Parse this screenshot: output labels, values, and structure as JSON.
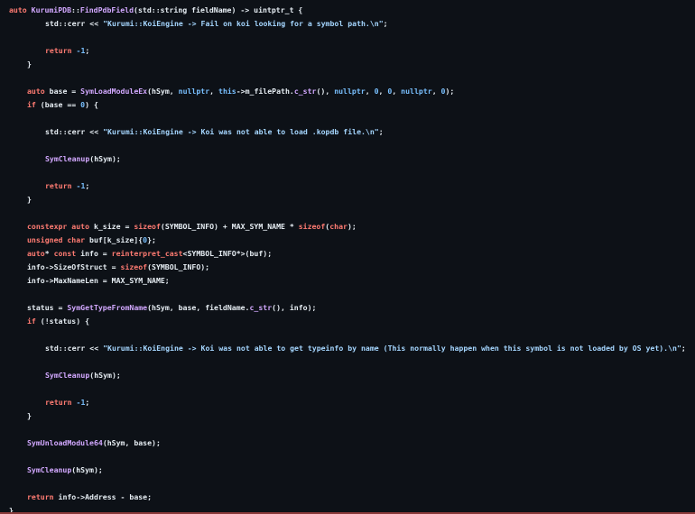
{
  "theme": {
    "background": "#0d1117",
    "text": "#e6edf3",
    "keyword": "#ff7b72",
    "function": "#d2a8ff",
    "type": "#79c0ff",
    "string": "#a5d6ff",
    "number": "#79c0ff"
  },
  "code": {
    "lines": [
      {
        "indent": 0,
        "tokens": [
          {
            "t": "auto ",
            "c": "keyword"
          },
          {
            "t": "KurumiPDB",
            "c": "function"
          },
          {
            "t": "::",
            "c": "plain"
          },
          {
            "t": "FindPdbField",
            "c": "function"
          },
          {
            "t": "(std::string fieldName) -> uintptr_t {",
            "c": "plain"
          }
        ]
      },
      {
        "indent": 2,
        "tokens": [
          {
            "t": "std::cerr << ",
            "c": "plain"
          },
          {
            "t": "\"Kurumi::KoiEngine -> Fail on koi looking for a symbol path.\\n\"",
            "c": "string"
          },
          {
            "t": ";",
            "c": "plain"
          }
        ]
      },
      {
        "indent": 2,
        "tokens": [
          {
            "t": "return ",
            "c": "keyword"
          },
          {
            "t": "-1",
            "c": "number"
          },
          {
            "t": ";",
            "c": "plain"
          }
        ]
      },
      {
        "indent": 1,
        "tokens": [
          {
            "t": "}",
            "c": "plain"
          }
        ]
      },
      {
        "indent": 1,
        "tokens": [
          {
            "t": "auto ",
            "c": "keyword"
          },
          {
            "t": "base = ",
            "c": "plain"
          },
          {
            "t": "SymLoadModuleEx",
            "c": "function"
          },
          {
            "t": "(hSym, ",
            "c": "plain"
          },
          {
            "t": "nullptr",
            "c": "type"
          },
          {
            "t": ", ",
            "c": "plain"
          },
          {
            "t": "this",
            "c": "type"
          },
          {
            "t": "->m_filePath.",
            "c": "plain"
          },
          {
            "t": "c_str",
            "c": "function"
          },
          {
            "t": "(), ",
            "c": "plain"
          },
          {
            "t": "nullptr",
            "c": "type"
          },
          {
            "t": ", ",
            "c": "plain"
          },
          {
            "t": "0",
            "c": "number"
          },
          {
            "t": ", ",
            "c": "plain"
          },
          {
            "t": "0",
            "c": "number"
          },
          {
            "t": ", ",
            "c": "plain"
          },
          {
            "t": "nullptr",
            "c": "type"
          },
          {
            "t": ", ",
            "c": "plain"
          },
          {
            "t": "0",
            "c": "number"
          },
          {
            "t": ");",
            "c": "plain"
          }
        ]
      },
      {
        "indent": 1,
        "tokens": [
          {
            "t": "if ",
            "c": "keyword"
          },
          {
            "t": "(base == ",
            "c": "plain"
          },
          {
            "t": "0",
            "c": "number"
          },
          {
            "t": ") {",
            "c": "plain"
          }
        ]
      },
      {
        "indent": 2,
        "tokens": [
          {
            "t": "std::cerr << ",
            "c": "plain"
          },
          {
            "t": "\"Kurumi::KoiEngine -> Koi was not able to load .kopdb file.\\n\"",
            "c": "string"
          },
          {
            "t": ";",
            "c": "plain"
          }
        ]
      },
      {
        "indent": 2,
        "tokens": [
          {
            "t": "SymCleanup",
            "c": "function"
          },
          {
            "t": "(hSym);",
            "c": "plain"
          }
        ]
      },
      {
        "indent": 2,
        "tokens": [
          {
            "t": "return ",
            "c": "keyword"
          },
          {
            "t": "-1",
            "c": "number"
          },
          {
            "t": ";",
            "c": "plain"
          }
        ]
      },
      {
        "indent": 1,
        "tokens": [
          {
            "t": "}",
            "c": "plain"
          }
        ]
      },
      {
        "indent": 1,
        "tokens": [
          {
            "t": "constexpr auto ",
            "c": "keyword"
          },
          {
            "t": "k_size = ",
            "c": "plain"
          },
          {
            "t": "sizeof",
            "c": "keyword"
          },
          {
            "t": "(SYMBOL_INFO) + MAX_SYM_NAME * ",
            "c": "plain"
          },
          {
            "t": "sizeof",
            "c": "keyword"
          },
          {
            "t": "(",
            "c": "plain"
          },
          {
            "t": "char",
            "c": "keyword"
          },
          {
            "t": ");",
            "c": "plain"
          }
        ]
      },
      {
        "indent": 1,
        "tokens": [
          {
            "t": "unsigned char ",
            "c": "keyword"
          },
          {
            "t": "buf[k_size]{",
            "c": "plain"
          },
          {
            "t": "0",
            "c": "number"
          },
          {
            "t": "};",
            "c": "plain"
          }
        ]
      },
      {
        "indent": 1,
        "tokens": [
          {
            "t": "auto",
            "c": "keyword"
          },
          {
            "t": "* ",
            "c": "plain"
          },
          {
            "t": "const ",
            "c": "keyword"
          },
          {
            "t": "info = ",
            "c": "plain"
          },
          {
            "t": "reinterpret_cast",
            "c": "keyword"
          },
          {
            "t": "<SYMBOL_INFO*>(buf);",
            "c": "plain"
          }
        ]
      },
      {
        "indent": 1,
        "tokens": [
          {
            "t": "info->SizeOfStruct = ",
            "c": "plain"
          },
          {
            "t": "sizeof",
            "c": "keyword"
          },
          {
            "t": "(SYMBOL_INFO);",
            "c": "plain"
          }
        ]
      },
      {
        "indent": 1,
        "tokens": [
          {
            "t": "info->MaxNameLen = MAX_SYM_NAME;",
            "c": "plain"
          }
        ]
      },
      {
        "indent": 1,
        "tokens": [
          {
            "t": "status = ",
            "c": "plain"
          },
          {
            "t": "SymGetTypeFromName",
            "c": "function"
          },
          {
            "t": "(hSym, base, fieldName.",
            "c": "plain"
          },
          {
            "t": "c_str",
            "c": "function"
          },
          {
            "t": "(), info);",
            "c": "plain"
          }
        ]
      },
      {
        "indent": 1,
        "tokens": [
          {
            "t": "if ",
            "c": "keyword"
          },
          {
            "t": "(!status) {",
            "c": "plain"
          }
        ]
      },
      {
        "indent": 2,
        "tokens": [
          {
            "t": "std::cerr << ",
            "c": "plain"
          },
          {
            "t": "\"Kurumi::KoiEngine -> Koi was not able to get typeinfo by name (This normally happen when this symbol is not loaded by OS yet).\\n\"",
            "c": "string"
          },
          {
            "t": ";",
            "c": "plain"
          }
        ]
      },
      {
        "indent": 2,
        "tokens": [
          {
            "t": "SymCleanup",
            "c": "function"
          },
          {
            "t": "(hSym);",
            "c": "plain"
          }
        ]
      },
      {
        "indent": 2,
        "tokens": [
          {
            "t": "return ",
            "c": "keyword"
          },
          {
            "t": "-1",
            "c": "number"
          },
          {
            "t": ";",
            "c": "plain"
          }
        ]
      },
      {
        "indent": 1,
        "tokens": [
          {
            "t": "}",
            "c": "plain"
          }
        ]
      },
      {
        "indent": 1,
        "tokens": [
          {
            "t": "SymUnloadModule64",
            "c": "function"
          },
          {
            "t": "(hSym, base);",
            "c": "plain"
          }
        ]
      },
      {
        "indent": 1,
        "tokens": [
          {
            "t": "SymCleanup",
            "c": "function"
          },
          {
            "t": "(hSym);",
            "c": "plain"
          }
        ]
      },
      {
        "indent": 1,
        "tokens": [
          {
            "t": "return ",
            "c": "keyword"
          },
          {
            "t": "info->Address - base;",
            "c": "plain"
          }
        ]
      },
      {
        "indent": 0,
        "tokens": [
          {
            "t": "}",
            "c": "plain"
          }
        ]
      }
    ]
  }
}
